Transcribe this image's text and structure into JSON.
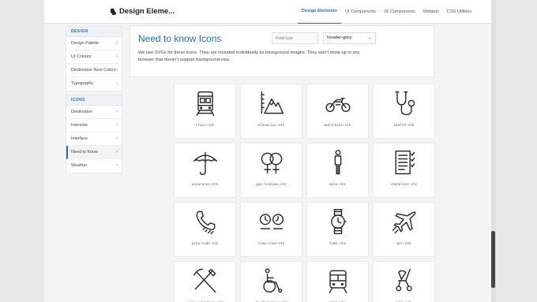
{
  "header": {
    "logo_text": "Design Eleme...",
    "nav": [
      {
        "label": "Design Elements"
      },
      {
        "label": "UI Components"
      },
      {
        "label": "JS Components"
      },
      {
        "label": "Widgets"
      },
      {
        "label": "CSS Utilities"
      }
    ],
    "active_nav": "Design Elements",
    "accent": "#1d6fb8"
  },
  "sidebar": {
    "design_heading": "DESIGN",
    "design_items": [
      {
        "label": "Design Palette"
      },
      {
        "label": "UI Colours"
      },
      {
        "label": "Destination Next Colors"
      },
      {
        "label": "Typography"
      }
    ],
    "icons_heading": "ICONS",
    "icons_items": [
      {
        "label": "Destination"
      },
      {
        "label": "Interests"
      },
      {
        "label": "Interface"
      },
      {
        "label": "Need to Know"
      },
      {
        "label": "Weather"
      }
    ],
    "active_item": "Need to Know"
  },
  "main": {
    "title": "Need to know Icons",
    "search": {
      "placeholder": "Find icon",
      "value": ""
    },
    "theme_select": {
      "value": "header-grey"
    },
    "description": "We use SVGs for these icons. They are included individually as background images. They won't show up in any browser that doesn't support background-size."
  },
  "icons": [
    {
      "label": "train-ntk",
      "icon": "train-icon"
    },
    {
      "label": "elevation-ntk",
      "icon": "elevation-icon"
    },
    {
      "label": "motorbike-ntk",
      "icon": "motorbike-icon"
    },
    {
      "label": "health-ntk",
      "icon": "stethoscope-icon"
    },
    {
      "label": "insurance-ntk",
      "icon": "umbrella-icon"
    },
    {
      "label": "gay-lesbian-ntk",
      "icon": "gay-lesbian-icon"
    },
    {
      "label": "male-ntk",
      "icon": "male-icon"
    },
    {
      "label": "checklist-ntk",
      "icon": "checklist-icon"
    },
    {
      "label": "area-code-ntk",
      "icon": "phone-icon"
    },
    {
      "label": "time-zone-ntk",
      "icon": "clocks-icon"
    },
    {
      "label": "time-ntk",
      "icon": "watch-icon"
    },
    {
      "label": "air-ntk",
      "icon": "airplane-icon"
    },
    {
      "label": "work-volunteer-ntk",
      "icon": "pick-shovel-icon"
    },
    {
      "label": "disabilities-ntk",
      "icon": "wheelchair-icon"
    },
    {
      "label": "tram-ntk",
      "icon": "tram-icon"
    },
    {
      "label": "kids-ntk",
      "icon": "stroller-icon"
    }
  ]
}
